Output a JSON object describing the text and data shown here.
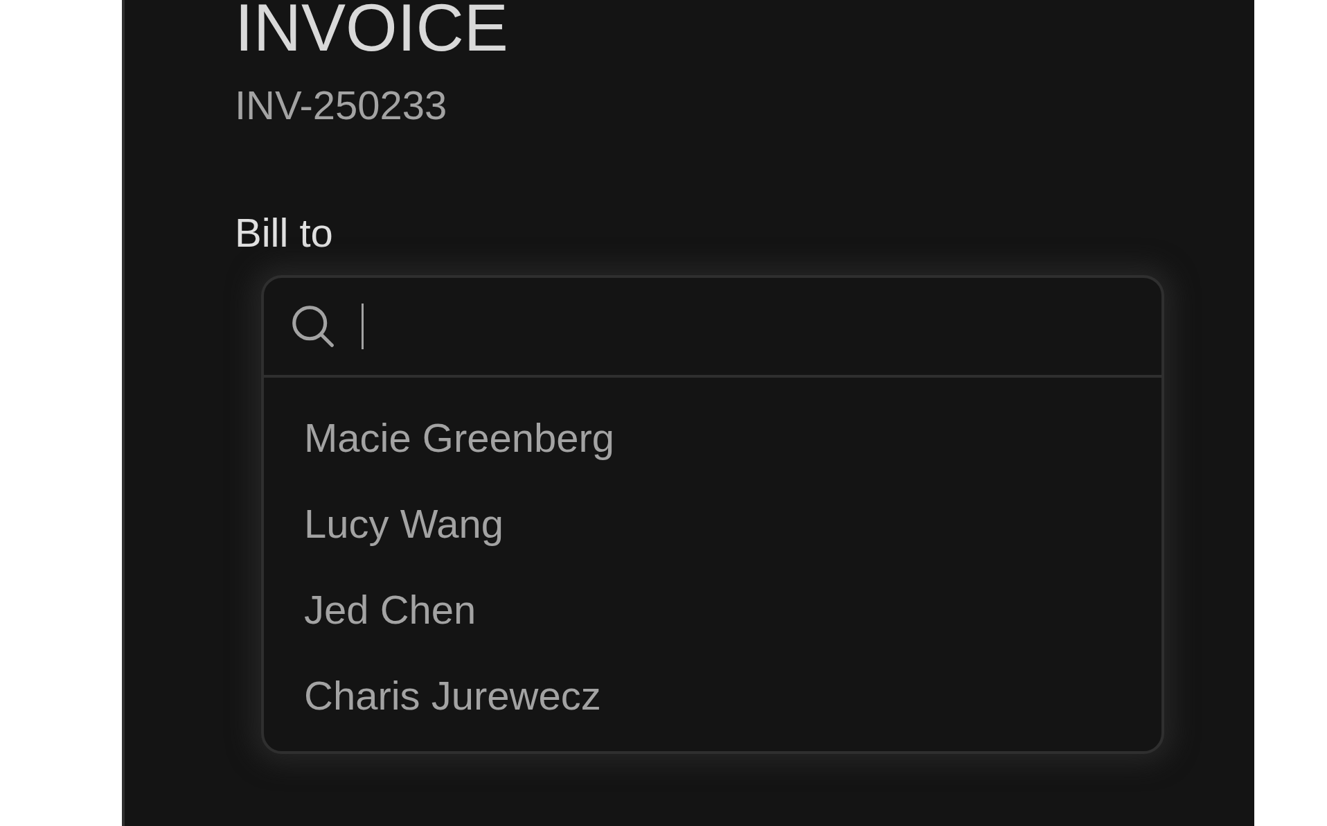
{
  "invoice": {
    "title": "INVOICE",
    "number": "INV-250233"
  },
  "bill_to": {
    "label": "Bill to",
    "search": {
      "focused": true
    },
    "options": [
      {
        "label": "Macie Greenberg",
        "selected": false
      },
      {
        "label": "Lucy Wang",
        "selected": false
      },
      {
        "label": "Jed Chen",
        "selected": false
      },
      {
        "label": "Charis Jurewecz",
        "selected": false
      }
    ]
  }
}
